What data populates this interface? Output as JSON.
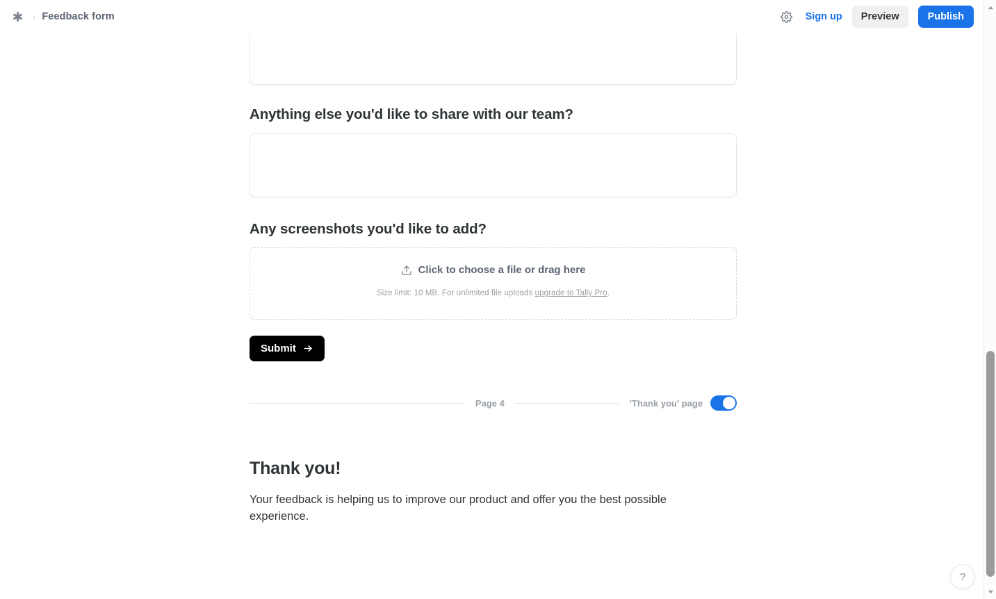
{
  "header": {
    "logo_icon": "asterisk-logo-icon",
    "breadcrumb_separator": "›",
    "form_title": "Feedback form",
    "settings_icon": "gear-icon",
    "signup_label": "Sign up",
    "preview_label": "Preview",
    "publish_label": "Publish",
    "accent_blue": "#1a73e8",
    "preview_bg": "#f0f0f0"
  },
  "form": {
    "questions": [
      {
        "title": "Anything else you'd like to share with our team?",
        "type": "textarea",
        "value": "",
        "placeholder": ""
      },
      {
        "title": "Any screenshots you'd like to add?",
        "type": "file-upload"
      }
    ],
    "upload": {
      "icon": "upload-icon",
      "cta": "Click to choose a file or drag here",
      "hint_prefix": "Size limit: 10 MB. For unlimited file uploads ",
      "hint_link": "upgrade to Tally Pro",
      "hint_suffix": "."
    },
    "submit": {
      "label": "Submit",
      "icon": "arrow-right-icon",
      "bg": "#000000"
    }
  },
  "page_divider": {
    "page_label": "Page 4",
    "thank_you_toggle_label": "'Thank you' page",
    "thank_you_toggle_state": "on"
  },
  "thank_you": {
    "heading": "Thank you!",
    "body": "Your feedback is helping us to improve our product and offer you the best possible experience."
  },
  "help": {
    "label": "?",
    "icon": "question-mark-icon"
  },
  "scrollbar": {
    "up_arrow_icon": "chevron-up-icon",
    "down_arrow_icon": "chevron-down-icon"
  }
}
